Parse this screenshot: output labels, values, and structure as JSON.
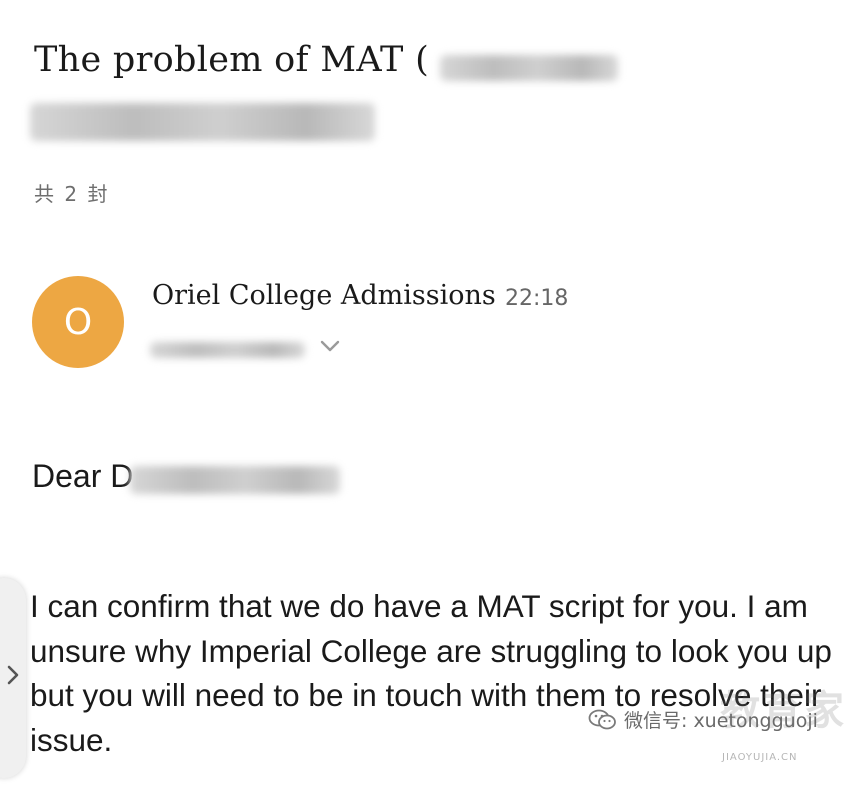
{
  "email": {
    "subject": "The problem of MAT (",
    "message_count": "共 2 封",
    "sender": {
      "avatar_letter": "O",
      "name": "Oriel College Admissions",
      "time": "22:18"
    },
    "greeting": "Dear D",
    "body": "I can confirm that we do have a MAT script for you. I am unsure why Imperial College are struggling to look you up but you will need to be in touch with them to resolve their issue."
  },
  "icons": {
    "recipient_expand": "chevron-down-icon",
    "side_panel": "chevron-right-icon",
    "wechat": "wechat-icon"
  },
  "watermark": {
    "wechat_label": "微信号: xuetongguoji",
    "logo": "教育家",
    "logo_sub": "JIAOYUJIA.CN"
  },
  "colors": {
    "avatar": "#EDA743",
    "text": "#1a1a1a",
    "muted": "#666666"
  }
}
